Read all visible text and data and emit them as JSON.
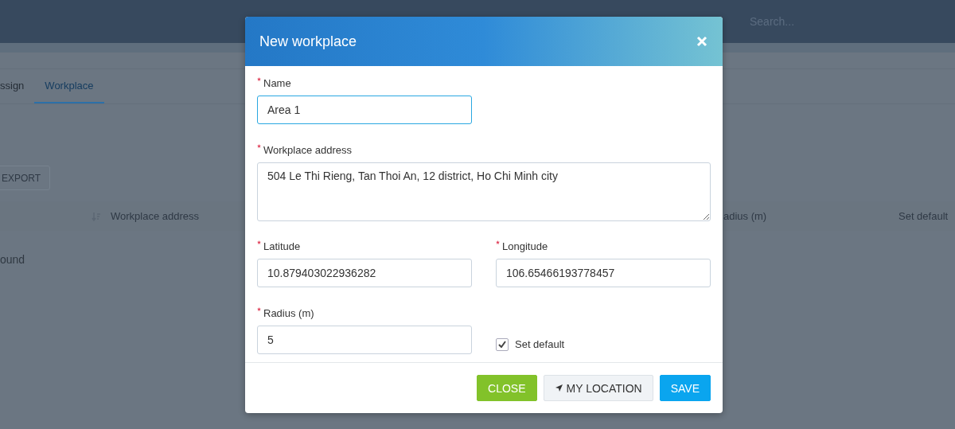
{
  "header": {
    "search": {
      "placeholder": "Search..."
    }
  },
  "tabs": [
    {
      "label": "ssign",
      "selected": false
    },
    {
      "label": "Workplace",
      "selected": true
    }
  ],
  "export_button": "EXPORT",
  "table": {
    "columns": [
      {
        "label": "Workplace address",
        "sortable": true
      },
      {
        "label": "adius (m)",
        "sortable": false
      },
      {
        "label": "Set default",
        "sortable": false
      }
    ],
    "empty_message": "ound"
  },
  "dialog": {
    "title": "New workplace",
    "fields": [
      {
        "kind": "text",
        "label": "Name",
        "required": true,
        "value": "Area 1",
        "focused": true
      },
      {
        "kind": "textarea",
        "label": "Workplace address",
        "required": true,
        "value": "504 Le Thi Rieng, Tan Thoi An, 12 district, Ho Chi Minh city",
        "focused": false
      },
      {
        "kind": "text",
        "label": "Latitude",
        "required": true,
        "value": "10.879403022936282",
        "focused": false
      },
      {
        "kind": "text",
        "label": "Longitude",
        "required": true,
        "value": "106.65466193778457",
        "focused": false
      },
      {
        "kind": "text",
        "label": "Radius (m)",
        "required": true,
        "value": "5",
        "focused": false
      },
      {
        "kind": "checkbox",
        "label": "Set default",
        "checked": true
      }
    ],
    "buttons": [
      {
        "kind": "close",
        "label": "CLOSE"
      },
      {
        "kind": "location",
        "label": "MY LOCATION"
      },
      {
        "kind": "save",
        "label": "SAVE"
      }
    ]
  }
}
